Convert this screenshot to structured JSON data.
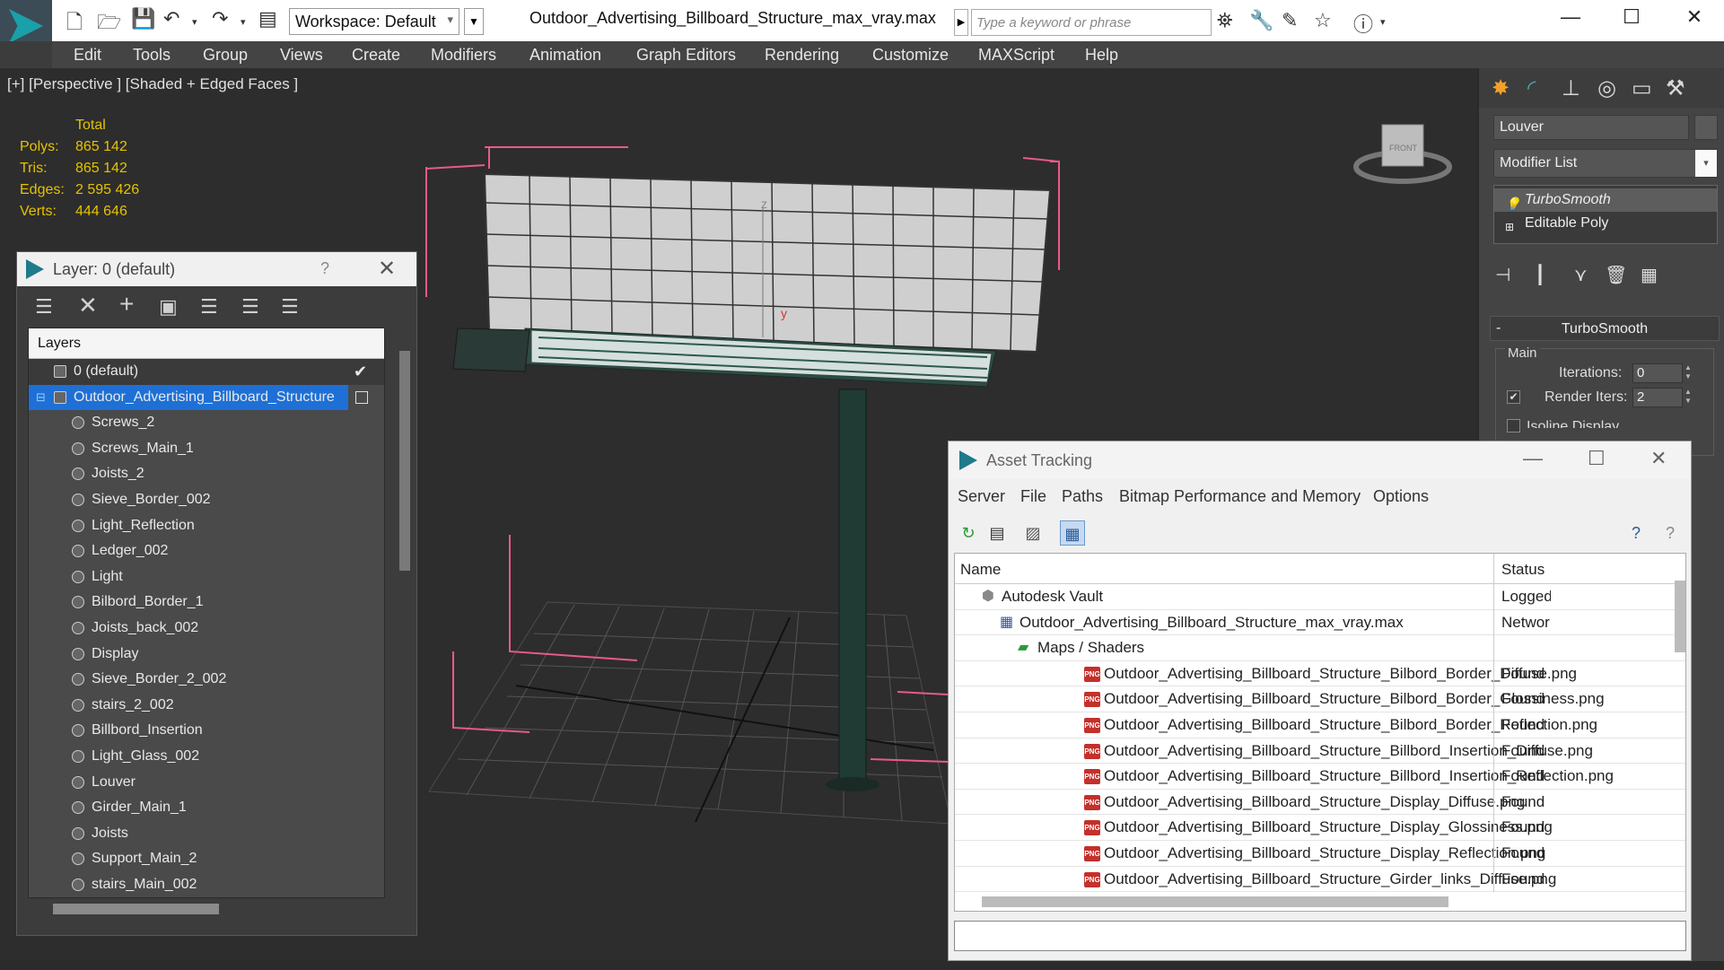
{
  "titlebar": {
    "workspace": "Workspace: Default",
    "file_title": "Outdoor_Advertising_Billboard_Structure_max_vray.max",
    "search_placeholder": "Type a keyword or phrase"
  },
  "menu": [
    "Edit",
    "Tools",
    "Group",
    "Views",
    "Create",
    "Modifiers",
    "Animation",
    "Graph Editors",
    "Rendering",
    "Customize",
    "MAXScript",
    "Help"
  ],
  "viewport": {
    "label": "[+] [Perspective ] [Shaded + Edged Faces ]",
    "stats": {
      "header": "Total",
      "polys_label": "Polys:",
      "polys": "865 142",
      "tris_label": "Tris:",
      "tris": "865 142",
      "edges_label": "Edges:",
      "edges": "2 595 426",
      "verts_label": "Verts:",
      "verts": "444 646"
    },
    "viewcube_label": "FRONT"
  },
  "layer_panel": {
    "title": "Layer: 0 (default)",
    "help": "?",
    "header": "Layers",
    "default_layer": "0 (default)",
    "selected_layer": "Outdoor_Advertising_Billboard_Structure",
    "objects": [
      "Screws_2",
      "Screws_Main_1",
      "Joists_2",
      "Sieve_Border_002",
      "Light_Reflection",
      "Ledger_002",
      "Light",
      "Bilbord_Border_1",
      "Joists_back_002",
      "Display",
      "Sieve_Border_2_002",
      "stairs_2_002",
      "Billbord_Insertion",
      "Light_Glass_002",
      "Louver",
      "Girder_Main_1",
      "Joists",
      "Support_Main_2",
      "stairs_Main_002"
    ]
  },
  "command_panel": {
    "object_name": "Louver",
    "modifier_list": "Modifier List",
    "stack": [
      "TurboSmooth",
      "Editable Poly"
    ],
    "rollout_title": "TurboSmooth",
    "group_label": "Main",
    "iterations_label": "Iterations:",
    "iterations": "0",
    "render_iters_label": "Render Iters:",
    "render_iters": "2",
    "render_iters_checked": true,
    "isoline_label": "Isoline Display"
  },
  "asset_tracking": {
    "title": "Asset Tracking",
    "menu": [
      "Server",
      "File",
      "Paths",
      "Bitmap Performance and Memory",
      "Options"
    ],
    "col_name": "Name",
    "col_status": "Status",
    "rows": [
      {
        "name": "Autodesk Vault",
        "status": "Logged",
        "indent": 0,
        "icon": "vault-icon"
      },
      {
        "name": "Outdoor_Advertising_Billboard_Structure_max_vray.max",
        "status": "Network",
        "indent": 1,
        "icon": "max-file-icon"
      },
      {
        "name": "Maps / Shaders",
        "status": "",
        "indent": 2,
        "icon": "maps-icon"
      },
      {
        "name": "Outdoor_Advertising_Billboard_Structure_Bilbord_Border_Diffuse.png",
        "status": "Found",
        "indent": 3,
        "icon": "png-icon"
      },
      {
        "name": "Outdoor_Advertising_Billboard_Structure_Bilbord_Border_Glossiness.png",
        "status": "Found",
        "indent": 3,
        "icon": "png-icon"
      },
      {
        "name": "Outdoor_Advertising_Billboard_Structure_Bilbord_Border_Reflection.png",
        "status": "Found",
        "indent": 3,
        "icon": "png-icon"
      },
      {
        "name": "Outdoor_Advertising_Billboard_Structure_Billbord_Insertion_Diffuse.png",
        "status": "Found",
        "indent": 3,
        "icon": "png-icon"
      },
      {
        "name": "Outdoor_Advertising_Billboard_Structure_Billbord_Insertion_Reflection.png",
        "status": "Found",
        "indent": 3,
        "icon": "png-icon"
      },
      {
        "name": "Outdoor_Advertising_Billboard_Structure_Display_Diffuse.png",
        "status": "Found",
        "indent": 3,
        "icon": "png-icon"
      },
      {
        "name": "Outdoor_Advertising_Billboard_Structure_Display_Glossiness.png",
        "status": "Found",
        "indent": 3,
        "icon": "png-icon"
      },
      {
        "name": "Outdoor_Advertising_Billboard_Structure_Display_Reflection.png",
        "status": "Found",
        "indent": 3,
        "icon": "png-icon"
      },
      {
        "name": "Outdoor_Advertising_Billboard_Structure_Girder_links_Diffuse.png",
        "status": "Found",
        "indent": 3,
        "icon": "png-icon"
      }
    ]
  }
}
